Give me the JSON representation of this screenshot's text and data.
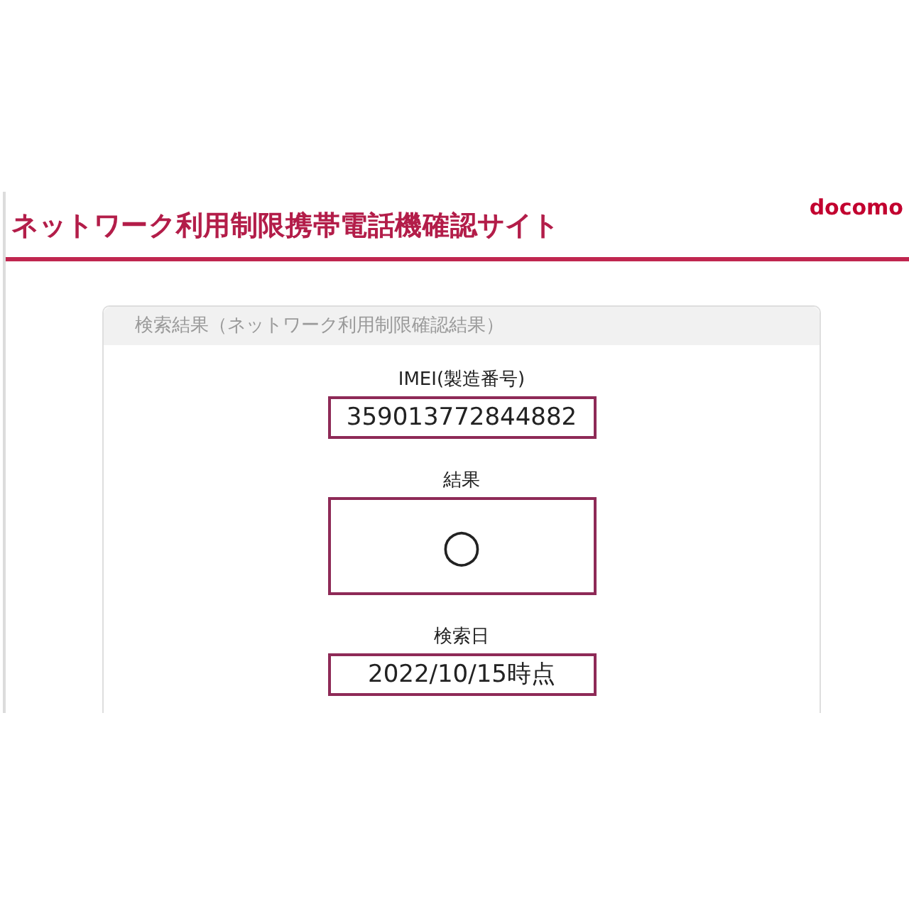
{
  "site": {
    "title": "ネットワーク利用制限携帯電話機確認サイト",
    "logo": "docomo"
  },
  "result_panel": {
    "heading": "検索結果（ネットワーク利用制限確認結果）",
    "fields": [
      {
        "kind": "text",
        "label": "IMEI(製造番号)",
        "value": "359013772844882"
      },
      {
        "kind": "mark",
        "label": "結果",
        "value": "○"
      },
      {
        "kind": "text",
        "label": "検索日",
        "value": "2022/10/15時点"
      }
    ]
  }
}
